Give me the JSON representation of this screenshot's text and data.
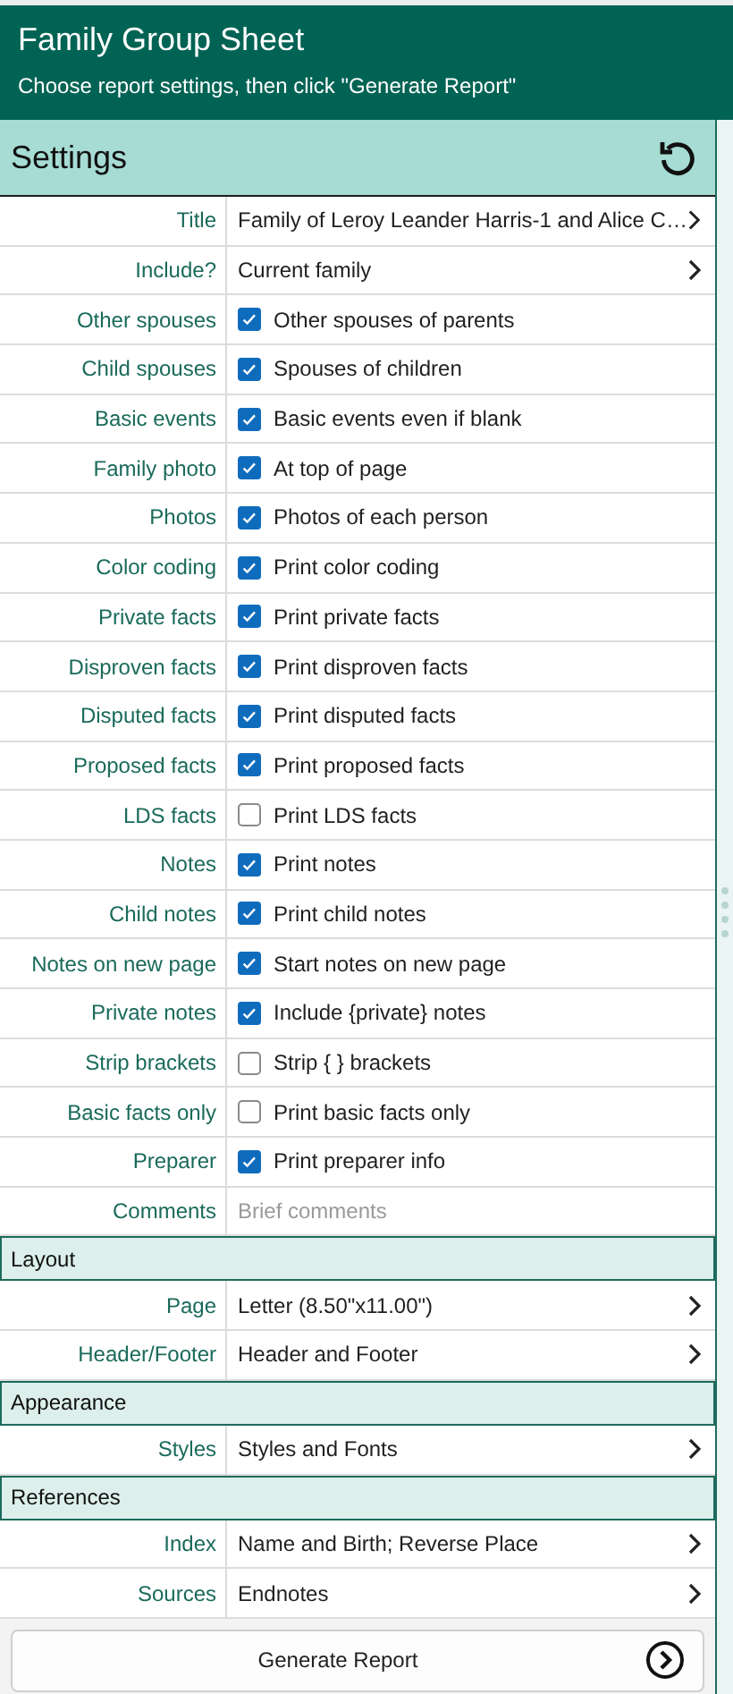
{
  "header": {
    "title": "Family Group Sheet",
    "subtitle": "Choose report settings, then click \"Generate Report\""
  },
  "sections": [
    {
      "kind": "main",
      "title": "Settings",
      "rows": [
        {
          "kind": "select",
          "label": "Title",
          "value": "Family of Leroy Leander Harris-1 and Alice C…"
        },
        {
          "kind": "select",
          "label": "Include?",
          "value": "Current family"
        },
        {
          "kind": "check",
          "label": "Other spouses",
          "text": "Other spouses of parents",
          "checked": true
        },
        {
          "kind": "check",
          "label": "Child spouses",
          "text": "Spouses of children",
          "checked": true
        },
        {
          "kind": "check",
          "label": "Basic events",
          "text": "Basic events even if blank",
          "checked": true
        },
        {
          "kind": "check",
          "label": "Family photo",
          "text": "At top of page",
          "checked": true
        },
        {
          "kind": "check",
          "label": "Photos",
          "text": "Photos of each person",
          "checked": true
        },
        {
          "kind": "check",
          "label": "Color coding",
          "text": "Print color coding",
          "checked": true
        },
        {
          "kind": "check",
          "label": "Private facts",
          "text": "Print private facts",
          "checked": true
        },
        {
          "kind": "check",
          "label": "Disproven facts",
          "text": "Print disproven facts",
          "checked": true
        },
        {
          "kind": "check",
          "label": "Disputed facts",
          "text": "Print disputed facts",
          "checked": true
        },
        {
          "kind": "check",
          "label": "Proposed facts",
          "text": "Print proposed facts",
          "checked": true
        },
        {
          "kind": "check",
          "label": "LDS facts",
          "text": "Print LDS facts",
          "checked": false
        },
        {
          "kind": "check",
          "label": "Notes",
          "text": "Print notes",
          "checked": true
        },
        {
          "kind": "check",
          "label": "Child notes",
          "text": "Print child notes",
          "checked": true
        },
        {
          "kind": "check",
          "label": "Notes on new page",
          "text": "Start notes on new page",
          "checked": true
        },
        {
          "kind": "check",
          "label": "Private notes",
          "text": "Include {private} notes",
          "checked": true
        },
        {
          "kind": "check",
          "label": "Strip brackets",
          "text": "Strip { } brackets",
          "checked": false
        },
        {
          "kind": "check",
          "label": "Basic facts only",
          "text": "Print basic facts only",
          "checked": false
        },
        {
          "kind": "check",
          "label": "Preparer",
          "text": "Print preparer info",
          "checked": true
        },
        {
          "kind": "input",
          "label": "Comments",
          "placeholder": "Brief comments"
        }
      ]
    },
    {
      "kind": "group",
      "title": "Layout",
      "rows": [
        {
          "kind": "select",
          "label": "Page",
          "value": "Letter (8.50\"x11.00\")"
        },
        {
          "kind": "select",
          "label": "Header/Footer",
          "value": "Header and Footer"
        }
      ]
    },
    {
      "kind": "group",
      "title": "Appearance",
      "rows": [
        {
          "kind": "select",
          "label": "Styles",
          "value": "Styles and Fonts"
        }
      ]
    },
    {
      "kind": "group",
      "title": "References",
      "rows": [
        {
          "kind": "select",
          "label": "Index",
          "value": "Name and Birth; Reverse Place"
        },
        {
          "kind": "select",
          "label": "Sources",
          "value": "Endnotes"
        }
      ]
    }
  ],
  "generate_button": {
    "label": "Generate Report"
  }
}
